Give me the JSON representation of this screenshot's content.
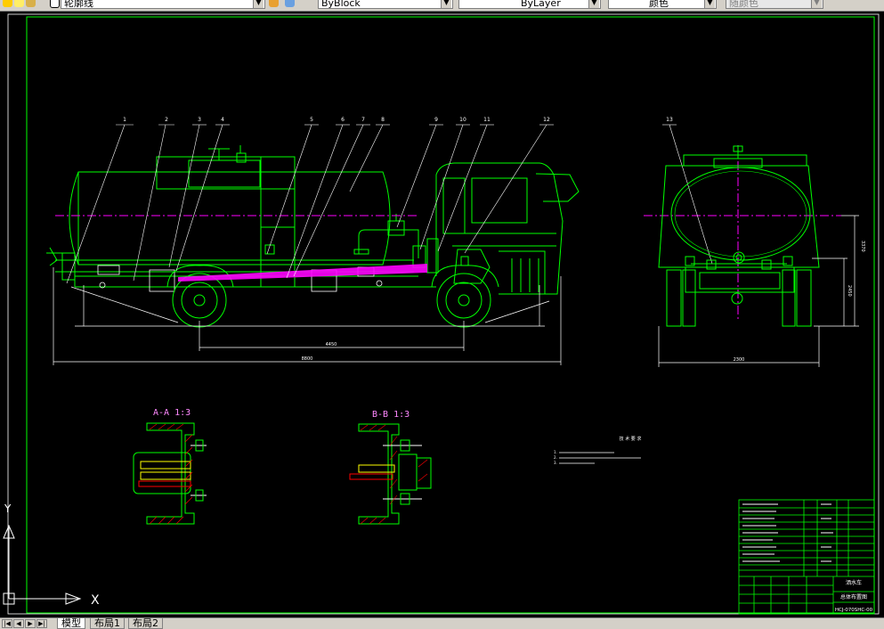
{
  "toolbar": {
    "layer_name": "轮廓线",
    "linetype": "ByBlock",
    "lineweight": "ByLayer",
    "color": "颜色",
    "plot_style": "随颜色"
  },
  "drawing": {
    "section_aa_label": "A-A 1:3",
    "section_bb_label": "B-B 1:3",
    "tech_req_title": "技 术 要 求",
    "tech_req_items": [
      "1.",
      "2.",
      "3."
    ],
    "callouts": [
      "1",
      "2",
      "3",
      "4",
      "5",
      "6",
      "7",
      "8",
      "9",
      "10",
      "11",
      "12",
      "13"
    ],
    "dimensions": {
      "wheelbase": "4450",
      "overall_length": "8800",
      "rear_width": "2300",
      "rear_height_right": "3370",
      "rear_height_left": "2450"
    },
    "title_block": {
      "drawing_number": "HCJ-070SHC-00",
      "company_title": "洒水车",
      "subtitle": "总体布置图"
    }
  },
  "ucs": {
    "x_label": "X",
    "y_label": "Y"
  },
  "tabs": {
    "model": "模型",
    "layout1": "布局1",
    "layout2": "布局2"
  },
  "colors": {
    "background": "#000000",
    "frame": "#00ff00",
    "centerline": "#ff00ff",
    "drawing_white": "#ffffff",
    "label_pink": "#ff88ff",
    "hatch_yellow": "#ffff00"
  }
}
